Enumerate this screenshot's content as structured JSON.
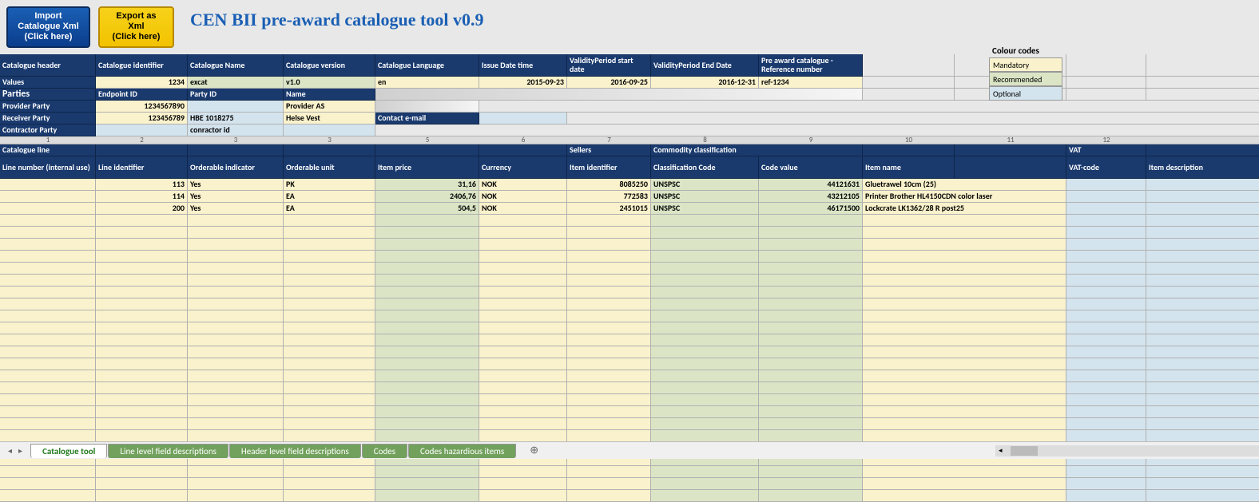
{
  "app": {
    "title": "CEN BII pre-award catalogue tool v0.9"
  },
  "buttons": {
    "import_line1": "Import",
    "import_line2": "Catalogue Xml",
    "import_line3": "(Click here)",
    "export_line1": "Export as",
    "export_line2": "Xml",
    "export_line3": "(Click here)"
  },
  "colorcodes": {
    "title": "Colour codes",
    "mandatory": "Mandatory",
    "recommended": "Recommended",
    "optional": "Optional"
  },
  "header_labels": {
    "catalogue_header": "Catalogue header",
    "catalogue_identifier": "Catalogue identifier",
    "catalogue_name": "Catalogue Name",
    "catalogue_version": "Catalogue version",
    "catalogue_language": "Catalogue Language",
    "issue_date": "Issue Date time",
    "validity_start": "ValidityPeriod start date",
    "validity_end": "ValidityPeriod End Date",
    "pre_award_ref": "Pre award catalogue - Reference number",
    "values": "Values",
    "parties": "Parties",
    "endpoint_id": "Endpoint ID",
    "party_id": "Party ID",
    "name": "Name",
    "provider_party": "Provider Party",
    "receiver_party": "Receiver Party",
    "contractor_party": "Contractor Party",
    "contact_email": "Contact e-mail",
    "catalogue_line": "Catalogue line",
    "sellers": "Sellers",
    "commodity_classification": "Commodity classification",
    "vat": "VAT",
    "line_number": "Line number (internal use)",
    "line_identifier": "Line identifier",
    "orderable_indicator": "Orderable indicator",
    "orderable_unit": "Orderable unit",
    "item_price": "Item price",
    "currency": "Currency",
    "item_identifier": "Item identifier",
    "classification_code": "Classification Code",
    "code_value": "Code value",
    "item_name": "Item name",
    "vat_code": "VAT-code",
    "item_description": "Item description"
  },
  "header_values": {
    "catalogue_identifier": "1234",
    "catalogue_name": "excat",
    "catalogue_version": "v1.0",
    "catalogue_language": "en",
    "issue_date": "2015-09-23",
    "validity_start": "2016-09-25",
    "validity_end": "2016-12-31",
    "pre_award_ref": "ref-1234"
  },
  "parties": {
    "provider": {
      "endpoint_id": "1234567890",
      "party_id": "",
      "name": "Provider AS"
    },
    "receiver": {
      "endpoint_id": "123456789",
      "party_id": "HBE 1018275",
      "name": "Helse Vest",
      "email": ""
    },
    "contractor": {
      "endpoint_id": "",
      "party_id": "conractor id",
      "name": ""
    }
  },
  "col_numbers": [
    "1",
    "2",
    "3",
    "3",
    "5",
    "6",
    "7",
    "8",
    "9",
    "10",
    "11",
    "12",
    ""
  ],
  "lines": [
    {
      "id": "113",
      "orderable": "Yes",
      "unit": "PK",
      "price": "31,16",
      "currency": "NOK",
      "item_id": "8085250",
      "class_code": "UNSPSC",
      "code_value": "44121631",
      "name": "Gluetrawel 10cm (25)",
      "vat": "",
      "desc": ""
    },
    {
      "id": "114",
      "orderable": "Yes",
      "unit": "EA",
      "price": "2406,76",
      "currency": "NOK",
      "item_id": "772583",
      "class_code": "UNSPSC",
      "code_value": "43212105",
      "name": "Printer Brother HL4150CDN color laser",
      "vat": "",
      "desc": ""
    },
    {
      "id": "200",
      "orderable": "Yes",
      "unit": "EA",
      "price": "504,5",
      "currency": "NOK",
      "item_id": "2451015",
      "class_code": "UNSPSC",
      "code_value": "46171500",
      "name": "Lockcrate LK1362/28 R post25",
      "vat": "",
      "desc": ""
    }
  ],
  "tabs": {
    "items": [
      "Catalogue tool",
      "Line level field descriptions",
      "Header level field descriptions",
      "Codes",
      "Codes hazardious items"
    ],
    "active": 0
  }
}
